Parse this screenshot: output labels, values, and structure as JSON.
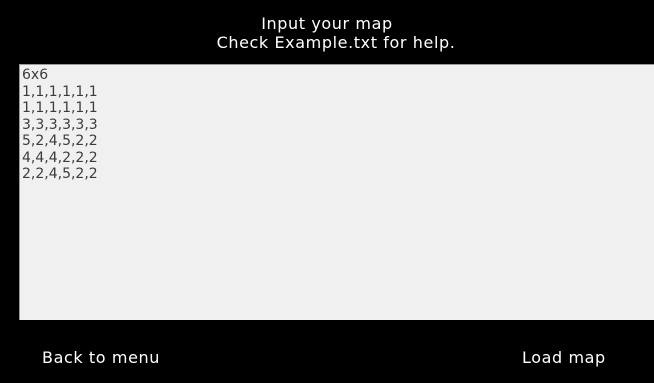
{
  "header": {
    "line1": "Input your map",
    "line2": "Check Example.txt for help."
  },
  "map_input": {
    "lines": [
      "6x6",
      "1,1,1,1,1,1",
      "1,1,1,1,1,1",
      "3,3,3,3,3,3",
      "5,2,4,5,2,2",
      "4,4,4,2,2,2",
      "2,2,4,5,2,2"
    ]
  },
  "buttons": {
    "back": "Back to menu",
    "load": "Load map"
  },
  "colors": {
    "background": "#000000",
    "text_area": "#f0f0f0",
    "text": "#ffffff",
    "input_text": "#3c3c3c"
  }
}
